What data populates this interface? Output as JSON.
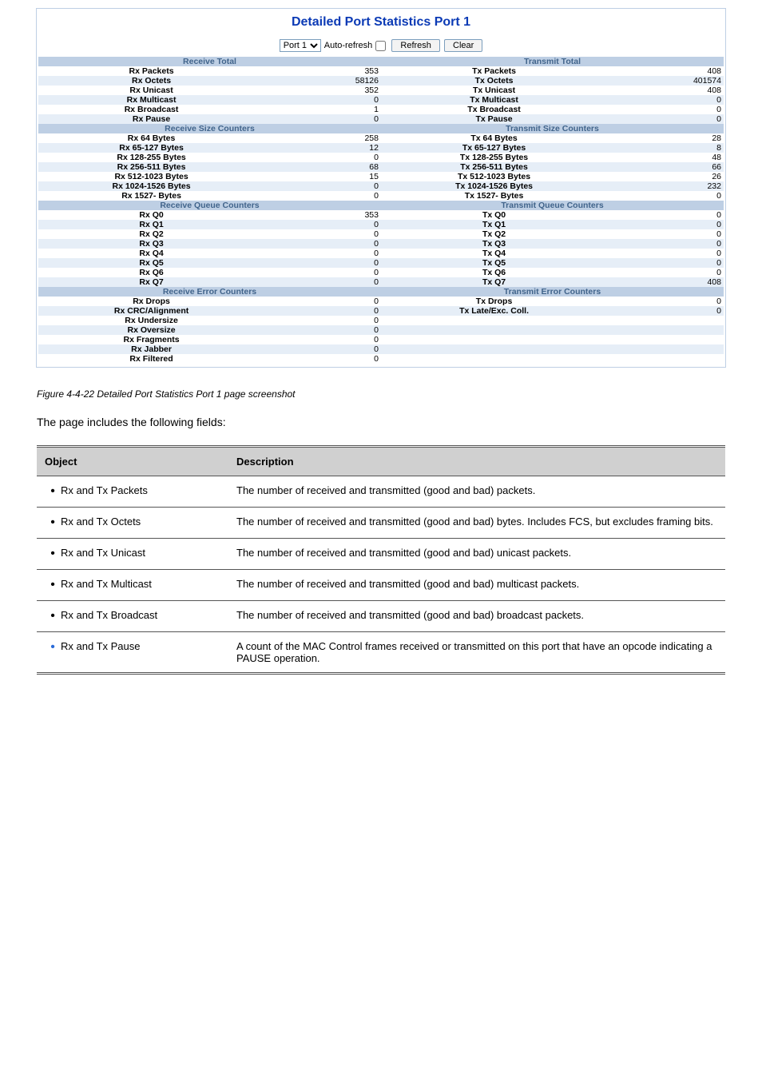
{
  "panel": {
    "title": "Detailed Port Statistics Port 1",
    "port_label": "Port 1",
    "auto_refresh_label": "Auto-refresh",
    "refresh_btn": "Refresh",
    "clear_btn": "Clear"
  },
  "sections": {
    "recv_total": "Receive Total",
    "tx_total": "Transmit Total",
    "recv_size": "Receive Size Counters",
    "tx_size": "Transmit Size Counters",
    "recv_queue": "Receive Queue Counters",
    "tx_queue": "Transmit Queue Counters",
    "recv_err": "Receive Error Counters",
    "tx_err": "Transmit Error Counters"
  },
  "total_rows": [
    {
      "rl": "Rx Packets",
      "rv": "353",
      "tl": "Tx Packets",
      "tv": "408",
      "alt": false
    },
    {
      "rl": "Rx Octets",
      "rv": "58126",
      "tl": "Tx Octets",
      "tv": "401574",
      "alt": true
    },
    {
      "rl": "Rx Unicast",
      "rv": "352",
      "tl": "Tx Unicast",
      "tv": "408",
      "alt": false
    },
    {
      "rl": "Rx Multicast",
      "rv": "0",
      "tl": "Tx Multicast",
      "tv": "0",
      "alt": true
    },
    {
      "rl": "Rx Broadcast",
      "rv": "1",
      "tl": "Tx Broadcast",
      "tv": "0",
      "alt": false
    },
    {
      "rl": "Rx Pause",
      "rv": "0",
      "tl": "Tx Pause",
      "tv": "0",
      "alt": true
    }
  ],
  "size_rows": [
    {
      "rl": "Rx 64 Bytes",
      "rv": "258",
      "tl": "Tx 64 Bytes",
      "tv": "28",
      "alt": false
    },
    {
      "rl": "Rx 65-127 Bytes",
      "rv": "12",
      "tl": "Tx 65-127 Bytes",
      "tv": "8",
      "alt": true
    },
    {
      "rl": "Rx 128-255 Bytes",
      "rv": "0",
      "tl": "Tx 128-255 Bytes",
      "tv": "48",
      "alt": false
    },
    {
      "rl": "Rx 256-511 Bytes",
      "rv": "68",
      "tl": "Tx 256-511 Bytes",
      "tv": "66",
      "alt": true
    },
    {
      "rl": "Rx 512-1023 Bytes",
      "rv": "15",
      "tl": "Tx 512-1023 Bytes",
      "tv": "26",
      "alt": false
    },
    {
      "rl": "Rx 1024-1526 Bytes",
      "rv": "0",
      "tl": "Tx 1024-1526 Bytes",
      "tv": "232",
      "alt": true
    },
    {
      "rl": "Rx 1527- Bytes",
      "rv": "0",
      "tl": "Tx 1527- Bytes",
      "tv": "0",
      "alt": false
    }
  ],
  "queue_rows": [
    {
      "rl": "Rx Q0",
      "rv": "353",
      "tl": "Tx Q0",
      "tv": "0",
      "alt": false
    },
    {
      "rl": "Rx Q1",
      "rv": "0",
      "tl": "Tx Q1",
      "tv": "0",
      "alt": true
    },
    {
      "rl": "Rx Q2",
      "rv": "0",
      "tl": "Tx Q2",
      "tv": "0",
      "alt": false
    },
    {
      "rl": "Rx Q3",
      "rv": "0",
      "tl": "Tx Q3",
      "tv": "0",
      "alt": true
    },
    {
      "rl": "Rx Q4",
      "rv": "0",
      "tl": "Tx Q4",
      "tv": "0",
      "alt": false
    },
    {
      "rl": "Rx Q5",
      "rv": "0",
      "tl": "Tx Q5",
      "tv": "0",
      "alt": true
    },
    {
      "rl": "Rx Q6",
      "rv": "0",
      "tl": "Tx Q6",
      "tv": "0",
      "alt": false
    },
    {
      "rl": "Rx Q7",
      "rv": "0",
      "tl": "Tx Q7",
      "tv": "408",
      "alt": true
    }
  ],
  "err_rows": [
    {
      "rl": "Rx Drops",
      "rv": "0",
      "tl": "Tx Drops",
      "tv": "0",
      "alt": false
    },
    {
      "rl": "Rx CRC/Alignment",
      "rv": "0",
      "tl": "Tx Late/Exc. Coll.",
      "tv": "0",
      "alt": true
    },
    {
      "rl": "Rx Undersize",
      "rv": "0",
      "tl": "",
      "tv": "",
      "alt": false
    },
    {
      "rl": "Rx Oversize",
      "rv": "0",
      "tl": "",
      "tv": "",
      "alt": true
    },
    {
      "rl": "Rx Fragments",
      "rv": "0",
      "tl": "",
      "tv": "",
      "alt": false
    },
    {
      "rl": "Rx Jabber",
      "rv": "0",
      "tl": "",
      "tv": "",
      "alt": true
    },
    {
      "rl": "Rx Filtered",
      "rv": "0",
      "tl": "",
      "tv": "",
      "alt": false
    }
  ],
  "figure_caption": "Figure 4-4-22 Detailed Port Statistics Port 1 page screenshot",
  "desc_intro": "The page includes the following fields:",
  "desc_header": {
    "object": "Object",
    "description": "Description"
  },
  "desc_rows": [
    {
      "obj": "Rx and Tx Packets",
      "desc": "The number of received and transmitted (good and bad) packets.",
      "blue": false
    },
    {
      "obj": "Rx and Tx Octets",
      "desc": "The number of received and transmitted (good and bad) bytes. Includes FCS, but excludes framing bits.",
      "blue": false
    },
    {
      "obj": "Rx and Tx Unicast",
      "desc": "The number of received and transmitted (good and bad) unicast packets.",
      "blue": false
    },
    {
      "obj": "Rx and Tx Multicast",
      "desc": "The number of received and transmitted (good and bad) multicast packets.",
      "blue": false
    },
    {
      "obj": "Rx and Tx Broadcast",
      "desc": "The number of received and transmitted (good and bad) broadcast packets.",
      "blue": false
    },
    {
      "obj": "Rx and Tx Pause",
      "desc": "A count of the MAC Control frames received or transmitted on this port that have an opcode indicating a PAUSE operation.",
      "blue": true
    }
  ]
}
